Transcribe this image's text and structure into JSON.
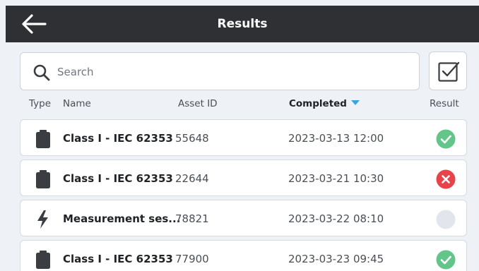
{
  "header": {
    "title": "Results",
    "back_icon": "arrow-left-icon"
  },
  "search": {
    "placeholder": "Search",
    "value": "",
    "icon": "search-icon"
  },
  "select_button": {
    "icon": "checkbox-checked-icon"
  },
  "columns": {
    "type": "Type",
    "name": "Name",
    "asset_id": "Asset ID",
    "completed": "Completed",
    "result": "Result",
    "sort_direction": "descending-arrow-icon"
  },
  "colors": {
    "header_bg": "#2f3034",
    "pass": "#63c58a",
    "fail": "#e8434a",
    "pending": "#e2e6ec",
    "sort_accent": "#3aa3e0"
  },
  "rows": [
    {
      "type_icon": "clipboard-icon",
      "name": "Class I - IEC 62353",
      "asset_id": "55648",
      "completed": "2023-03-13 12:00",
      "result": "pass"
    },
    {
      "type_icon": "clipboard-icon",
      "name": "Class I - IEC 62353",
      "asset_id": "22644",
      "completed": "2023-03-21 10:30",
      "result": "fail"
    },
    {
      "type_icon": "lightning-bolt-icon",
      "name": "Measurement ses...",
      "asset_id": "78821",
      "completed": "2023-03-22 08:10",
      "result": "pending"
    },
    {
      "type_icon": "clipboard-icon",
      "name": "Class I - IEC 62353",
      "asset_id": "77900",
      "completed": "2023-03-23 09:45",
      "result": "pass"
    }
  ]
}
